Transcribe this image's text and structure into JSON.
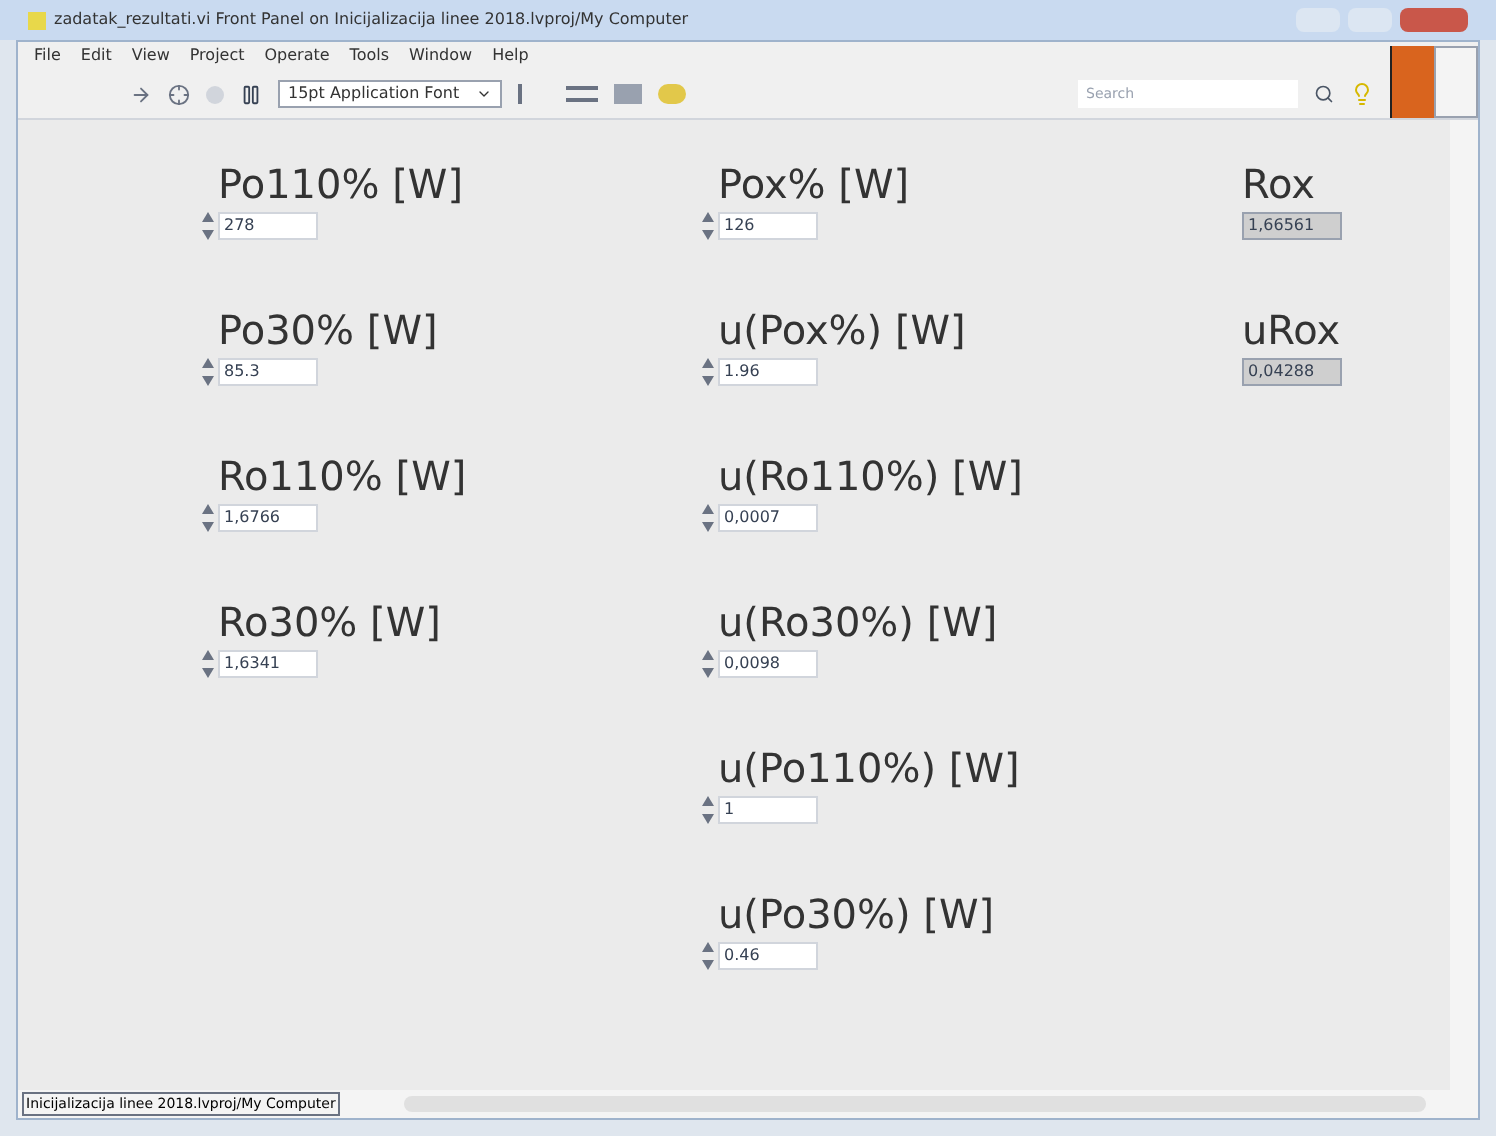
{
  "window": {
    "title": "zadatak_rezultati.vi Front Panel on Inicijalizacija linee 2018.lvproj/My Computer"
  },
  "menu": [
    "File",
    "Edit",
    "View",
    "Project",
    "Operate",
    "Tools",
    "Window",
    "Help"
  ],
  "toolbar": {
    "font": "15pt Application Font",
    "search": {
      "placeholder": "Search"
    }
  },
  "columns": [
    [
      {
        "label": "Po110% [W]",
        "value": "278",
        "kind": "control"
      },
      {
        "label": "Po30% [W]",
        "value": "85.3",
        "kind": "control"
      },
      {
        "label": "Ro110% [W]",
        "value": "1,6766",
        "kind": "control"
      },
      {
        "label": "Ro30% [W]",
        "value": "1,6341",
        "kind": "control"
      }
    ],
    [
      {
        "label": "Pox% [W]",
        "value": "126",
        "kind": "control"
      },
      {
        "label": "u(Pox%) [W]",
        "value": "1.96",
        "kind": "control"
      },
      {
        "label": "u(Ro110%) [W]",
        "value": "0,0007",
        "kind": "control"
      },
      {
        "label": "u(Ro30%) [W]",
        "value": "0,0098",
        "kind": "control"
      },
      {
        "label": "u(Po110%) [W]",
        "value": "1",
        "kind": "control"
      },
      {
        "label": "u(Po30%) [W]",
        "value": "0.46",
        "kind": "control"
      }
    ],
    [
      {
        "label": "Rox",
        "value": "1,66561",
        "kind": "indicator"
      },
      {
        "label": "uRox",
        "value": "0,04288",
        "kind": "indicator"
      }
    ]
  ],
  "status_bar": {
    "path": "Inicijalizacija linee 2018.lvproj/My Computer"
  }
}
